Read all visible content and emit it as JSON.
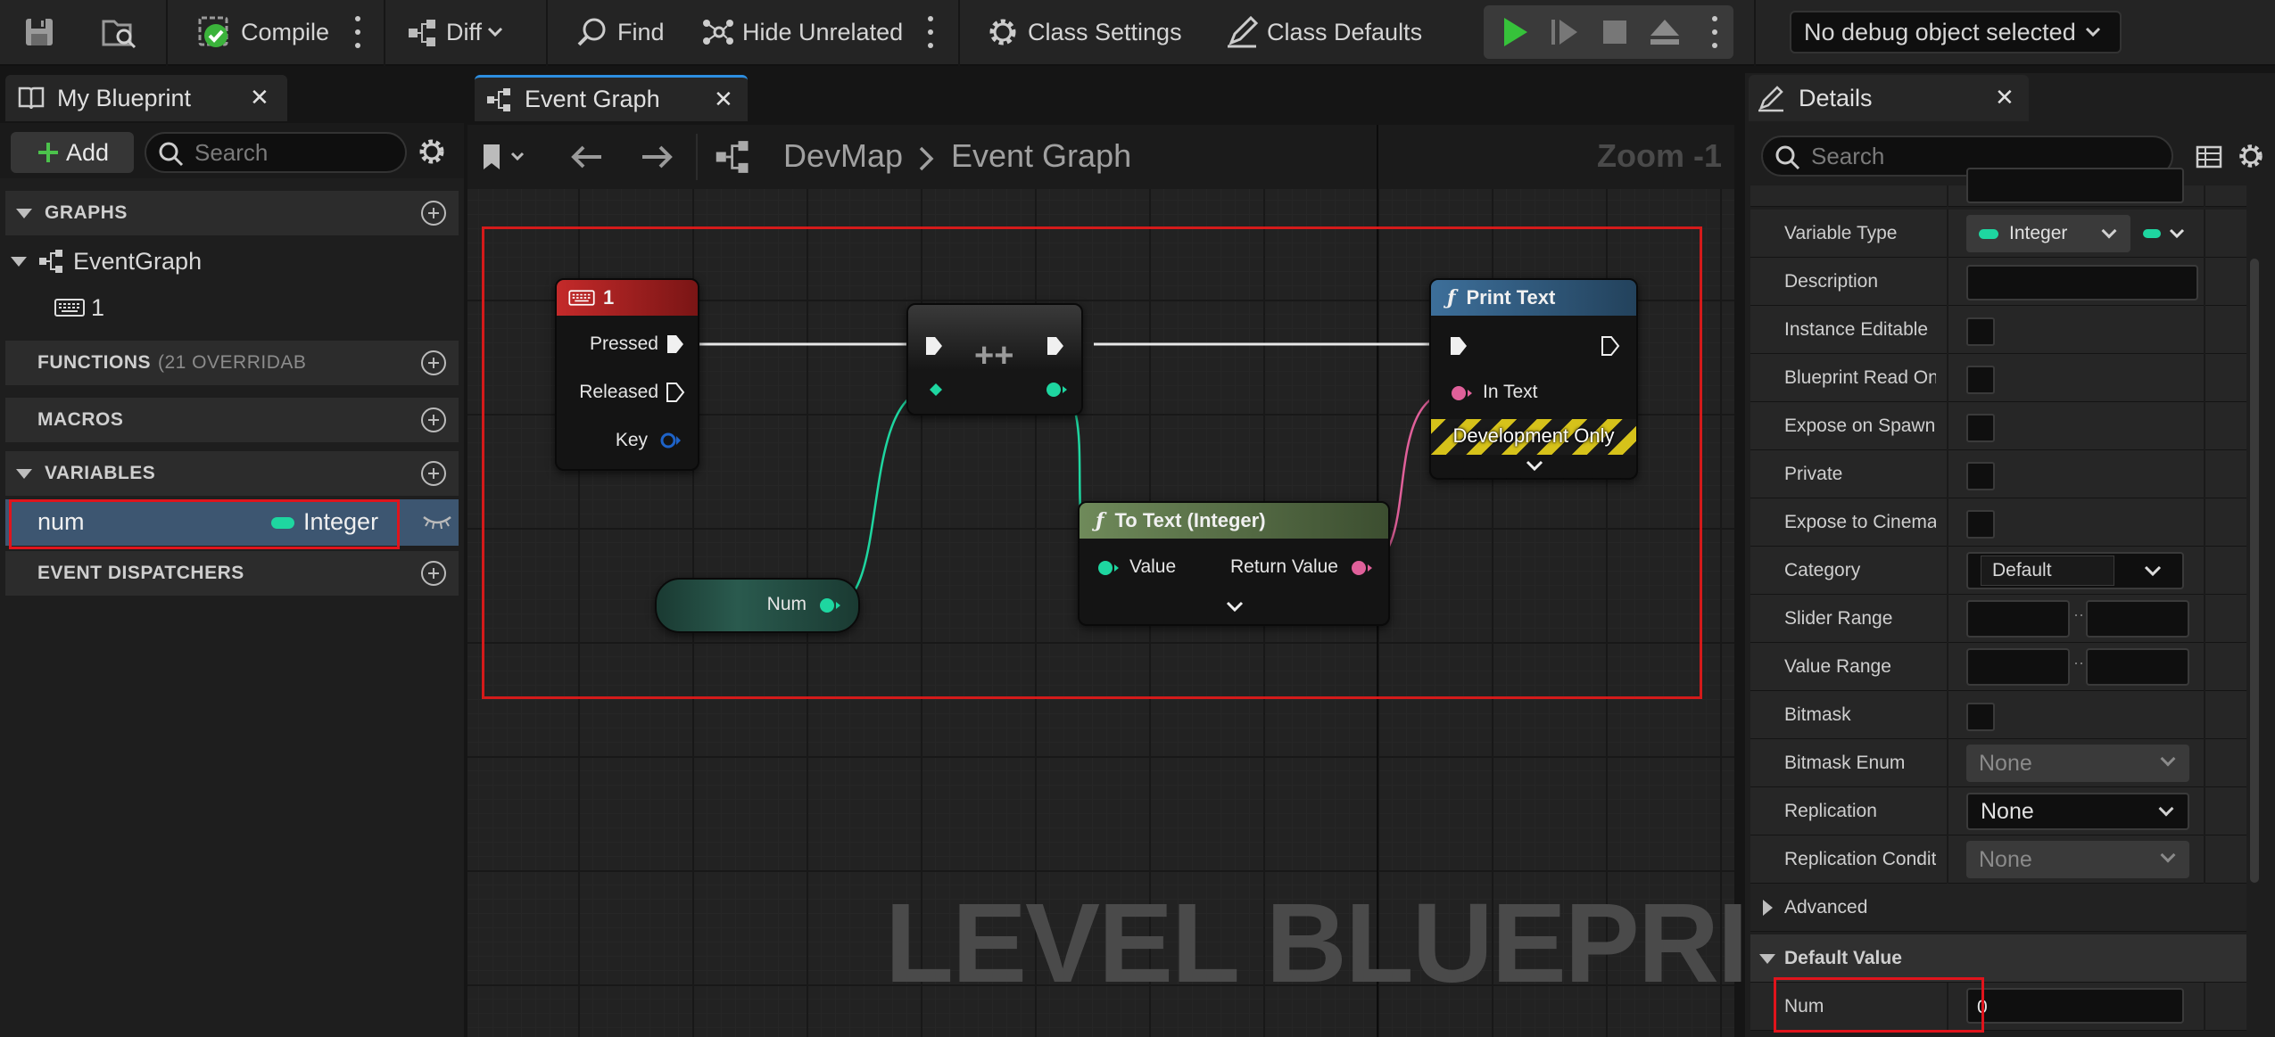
{
  "toolbar": {
    "compile_label": "Compile",
    "diff_label": "Diff",
    "find_label": "Find",
    "hide_unrelated_label": "Hide Unrelated",
    "class_settings_label": "Class Settings",
    "class_defaults_label": "Class Defaults",
    "debug_object": "No debug object selected"
  },
  "my_blueprint": {
    "tab_label": "My Blueprint",
    "add_label": "Add",
    "search_placeholder": "Search",
    "sections": {
      "graphs": "GRAPHS",
      "functions": "FUNCTIONS",
      "functions_note": "(21 OVERRIDAB",
      "macros": "MACROS",
      "variables": "VARIABLES",
      "dispatchers": "EVENT DISPATCHERS"
    },
    "graph_items": [
      "EventGraph",
      "1"
    ],
    "variable": {
      "name": "num",
      "type": "Integer"
    }
  },
  "graph": {
    "tab_label": "Event Graph",
    "breadcrumb_root": "DevMap",
    "breadcrumb_current": "Event Graph",
    "zoom": "Zoom -1",
    "watermark": "LEVEL BLUEPRINT",
    "nodes": {
      "key_event": {
        "title": "1",
        "pins": [
          "Pressed",
          "Released",
          "Key"
        ]
      },
      "increment": {
        "title": "++"
      },
      "num_getter": {
        "label": "Num"
      },
      "to_text": {
        "title": "To Text (Integer)",
        "in": "Value",
        "out": "Return Value"
      },
      "print_text": {
        "title": "Print Text",
        "in": "In Text",
        "banner": "Development Only"
      }
    }
  },
  "details": {
    "tab_label": "Details",
    "search_placeholder": "Search",
    "rows": {
      "variable_type": {
        "label": "Variable Type",
        "value": "Integer"
      },
      "description": "Description",
      "instance_editable": "Instance Editable",
      "read_only": "Blueprint Read Only",
      "expose_spawn": "Expose on Spawn",
      "private": "Private",
      "expose_cinematics": "Expose to Cinematics",
      "category": {
        "label": "Category",
        "value": "Default"
      },
      "slider_range": "Slider Range",
      "value_range": "Value Range",
      "bitmask": "Bitmask",
      "bitmask_enum": {
        "label": "Bitmask Enum",
        "value": "None"
      },
      "replication": {
        "label": "Replication",
        "value": "None"
      },
      "replication_condition": {
        "label": "Replication Condition",
        "value": "None"
      },
      "advanced": "Advanced"
    },
    "default_value": {
      "header": "Default Value",
      "label": "Num",
      "value": "0"
    }
  },
  "colors": {
    "accent_blue": "#2d8ee0",
    "integer_pin": "#1ed6a0",
    "text_pin": "#e0609a",
    "highlight_red": "#e0141c",
    "play_green": "#36c23a"
  }
}
